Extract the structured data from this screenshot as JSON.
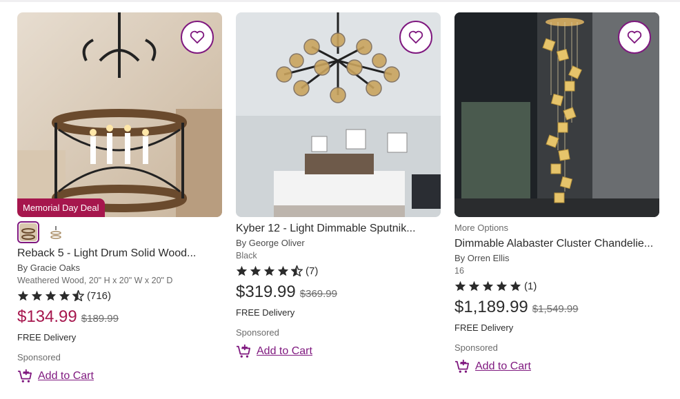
{
  "products": [
    {
      "deal_badge": "Memorial Day Deal",
      "more_options": "",
      "title": "Reback 5 - Light Drum Solid Wood...",
      "by": "By Gracie Oaks",
      "options": "Weathered Wood, 20\" H x 20\" W x 20\" D",
      "rating": 4.5,
      "review_count": "(716)",
      "price": "$134.99",
      "was_price": "$189.99",
      "delivery": "FREE Delivery",
      "sponsored": "Sponsored",
      "cart_label": "Add to Cart"
    },
    {
      "deal_badge": "",
      "more_options": "",
      "title": "Kyber 12 - Light Dimmable Sputnik...",
      "by": "By George Oliver",
      "options": "Black",
      "rating": 4.5,
      "review_count": "(7)",
      "price": "$319.99",
      "was_price": "$369.99",
      "delivery": "FREE Delivery",
      "sponsored": "Sponsored",
      "cart_label": "Add to Cart"
    },
    {
      "deal_badge": "",
      "more_options": "More Options",
      "title": "Dimmable Alabaster Cluster Chandelie...",
      "by": "By Orren Ellis",
      "options": "16",
      "rating": 5,
      "review_count": "(1)",
      "price": "$1,189.99",
      "was_price": "$1,549.99",
      "delivery": "FREE Delivery",
      "sponsored": "Sponsored",
      "cart_label": "Add to Cart"
    }
  ],
  "colors": {
    "brand_purple": "#7f187f",
    "sale_red": "#a6164d",
    "text": "#2b2b2b"
  }
}
